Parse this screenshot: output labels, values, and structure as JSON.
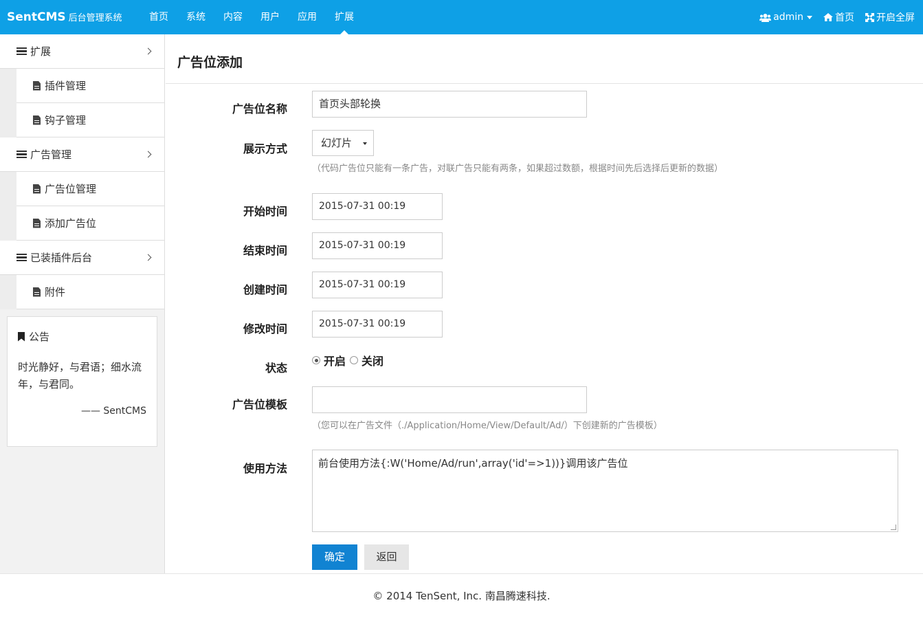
{
  "brand": {
    "name": "SentCMS",
    "subtitle": "后台管理系统"
  },
  "nav": [
    {
      "label": "首页"
    },
    {
      "label": "系统"
    },
    {
      "label": "内容"
    },
    {
      "label": "用户"
    },
    {
      "label": "应用"
    },
    {
      "label": "扩展"
    }
  ],
  "nav_right": {
    "user": "admin",
    "home": "首页",
    "fullscreen": "开启全屏"
  },
  "sidebar": {
    "groups": [
      {
        "label": "扩展",
        "items": [
          {
            "label": "插件管理"
          },
          {
            "label": "钩子管理"
          }
        ]
      },
      {
        "label": "广告管理",
        "items": [
          {
            "label": "广告位管理"
          },
          {
            "label": "添加广告位"
          }
        ]
      },
      {
        "label": "已装插件后台",
        "items": [
          {
            "label": "附件"
          }
        ]
      }
    ],
    "notice": {
      "title": "公告",
      "text": "时光静好，与君语；细水流年，与君同。",
      "sign": "—— SentCMS"
    }
  },
  "page": {
    "title": "广告位添加"
  },
  "form": {
    "name": {
      "label": "广告位名称",
      "value": "首页头部轮换"
    },
    "display": {
      "label": "展示方式",
      "value": "幻灯片",
      "help": "（代码广告位只能有一条广告，对联广告只能有两条，如果超过数额，根据时间先后选择后更新的数据）"
    },
    "start": {
      "label": "开始时间",
      "value": "2015-07-31 00:19"
    },
    "end": {
      "label": "结束时间",
      "value": "2015-07-31 00:19"
    },
    "created": {
      "label": "创建时间",
      "value": "2015-07-31 00:19"
    },
    "modified": {
      "label": "修改时间",
      "value": "2015-07-31 00:19"
    },
    "status": {
      "label": "状态",
      "on": "开启",
      "off": "关闭"
    },
    "template": {
      "label": "广告位模板",
      "value": "",
      "help": "（您可以在广告文件（./Application/Home/View/Default/Ad/）下创建新的广告模板）"
    },
    "usage": {
      "label": "使用方法",
      "value": "前台使用方法{:W('Home/Ad/run',array('id'=>1))}调用该广告位"
    },
    "submit": "确定",
    "back": "返回"
  },
  "footer": {
    "text": "© 2014 TenSent, Inc. 南昌腾速科技."
  },
  "colors": {
    "navbar": "#0ea0e6",
    "primary_button": "#1183d2"
  }
}
